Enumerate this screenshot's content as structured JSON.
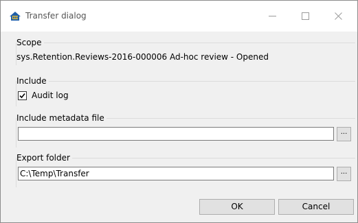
{
  "window": {
    "title": "Transfer dialog",
    "app_icon": "ilis-logo-icon"
  },
  "titlebar_buttons": {
    "minimize_icon": "minimize-icon",
    "maximize_icon": "maximize-icon",
    "close_icon": "close-icon"
  },
  "scope": {
    "legend": "Scope",
    "value": "sys.Retention.Reviews-2016-000006 Ad-hoc review - Opened"
  },
  "include": {
    "legend": "Include",
    "audit_log_label": "Audit log",
    "audit_log_checked": true
  },
  "metadata": {
    "legend": "Include metadata file",
    "value": "",
    "browse_label": "..."
  },
  "export": {
    "legend": "Export folder",
    "value": "C:\\Temp\\Transfer",
    "browse_label": "..."
  },
  "buttons": {
    "ok_label": "OK",
    "cancel_label": "Cancel"
  },
  "colors": {
    "window_bg": "#f0f0f0",
    "titlebar_bg": "#ffffff",
    "button_bg": "#e1e1e1"
  }
}
